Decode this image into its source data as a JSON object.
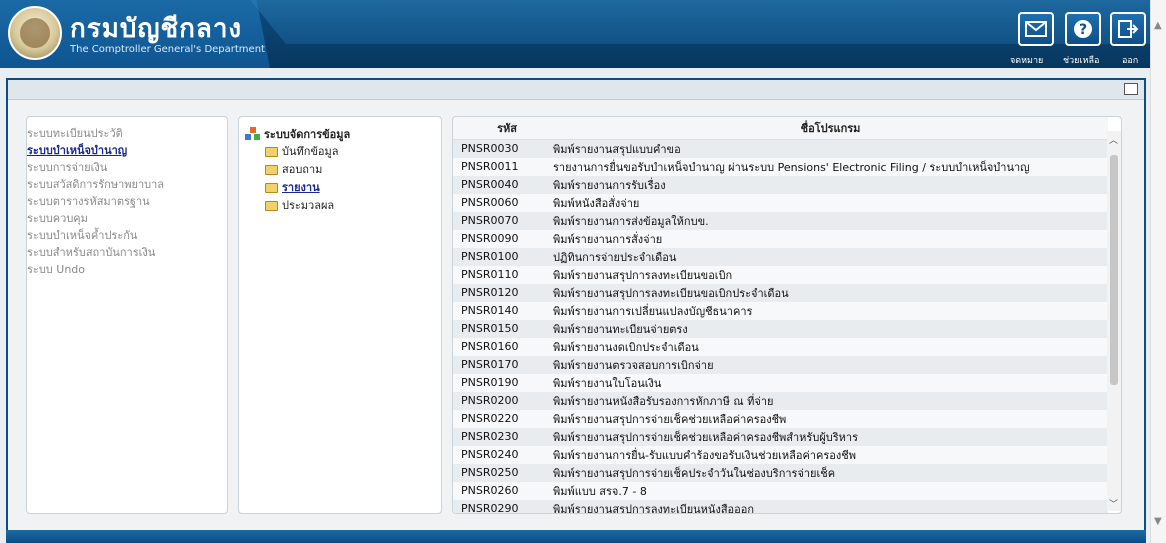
{
  "header": {
    "title": "กรมบัญชีกลาง",
    "subtitle": "The Comptroller General's Department",
    "buttons": [
      {
        "label": "จดหมาย",
        "icon": "mail-icon"
      },
      {
        "label": "ช่วยเหลือ",
        "icon": "help-icon"
      },
      {
        "label": "ออก",
        "icon": "exit-icon"
      }
    ]
  },
  "systems": {
    "items": [
      {
        "label": "ระบบทะเบียนประวัติ",
        "active": false
      },
      {
        "label": "ระบบบำเหน็จบำนาญ",
        "active": true
      },
      {
        "label": "ระบบการจ่ายเงิน",
        "active": false
      },
      {
        "label": "ระบบสวัสดิการรักษาพยาบาล",
        "active": false
      },
      {
        "label": "ระบบตารางรหัสมาตรฐาน",
        "active": false
      },
      {
        "label": "ระบบควบคุม",
        "active": false
      },
      {
        "label": "ระบบบำเหน็จค้ำประกัน",
        "active": false
      },
      {
        "label": "ระบบสำหรับสถาบันการเงิน",
        "active": false
      },
      {
        "label": "ระบบ Undo",
        "active": false
      }
    ]
  },
  "tree": {
    "root": "ระบบจัดการข้อมูล",
    "items": [
      {
        "label": "บันทึกข้อมูล",
        "active": false
      },
      {
        "label": "สอบถาม",
        "active": false
      },
      {
        "label": "รายงาน",
        "active": true
      },
      {
        "label": "ประมวลผล",
        "active": false
      }
    ]
  },
  "table": {
    "headers": {
      "code": "รหัส",
      "name": "ชื่อโปรแกรม"
    },
    "rows": [
      {
        "code": "PNSR0030",
        "name": "พิมพ์รายงานสรุปแบบคำขอ"
      },
      {
        "code": "PNSR0011",
        "name": "รายงานการยื่นขอรับบำเหน็จบำนาญ ผ่านระบบ Pensions' Electronic Filing / ระบบบำเหน็จบำนาญ"
      },
      {
        "code": "PNSR0040",
        "name": "พิมพ์รายงานการรับเรื่อง"
      },
      {
        "code": "PNSR0060",
        "name": "พิมพ์หนังสือสั่งจ่าย"
      },
      {
        "code": "PNSR0070",
        "name": "พิมพ์รายงานการส่งข้อมูลให้กบข."
      },
      {
        "code": "PNSR0090",
        "name": "พิมพ์รายงานการสั่งจ่าย"
      },
      {
        "code": "PNSR0100",
        "name": "ปฏิทินการจ่ายประจำเดือน"
      },
      {
        "code": "PNSR0110",
        "name": "พิมพ์รายงานสรุปการลงทะเบียนขอเบิก"
      },
      {
        "code": "PNSR0120",
        "name": "พิมพ์รายงานสรุปการลงทะเบียนขอเบิกประจำเดือน"
      },
      {
        "code": "PNSR0140",
        "name": "พิมพ์รายงานการเปลี่ยนแปลงบัญชีธนาคาร"
      },
      {
        "code": "PNSR0150",
        "name": "พิมพ์รายงานทะเบียนจ่ายตรง"
      },
      {
        "code": "PNSR0160",
        "name": "พิมพ์รายงานงดเบิกประจำเดือน"
      },
      {
        "code": "PNSR0170",
        "name": "พิมพ์รายงานตรวจสอบการเบิกจ่าย"
      },
      {
        "code": "PNSR0190",
        "name": "พิมพ์รายงานใบโอนเงิน"
      },
      {
        "code": "PNSR0200",
        "name": "พิมพ์รายงานหนังสือรับรองการหักภาษี ณ ที่จ่าย"
      },
      {
        "code": "PNSR0220",
        "name": "พิมพ์รายงานสรุปการจ่ายเช็คช่วยเหลือค่าครองชีพ"
      },
      {
        "code": "PNSR0230",
        "name": "พิมพ์รายงานสรุปการจ่ายเช็คช่วยเหลือค่าครองชีพสำหรับผู้บริหาร"
      },
      {
        "code": "PNSR0240",
        "name": "พิมพ์รายงานการยื่น-รับแบบคำร้องขอรับเงินช่วยเหลือค่าครองชีพ"
      },
      {
        "code": "PNSR0250",
        "name": "พิมพ์รายงานสรุปการจ่ายเช็คประจำวันในช่องบริการจ่ายเช็ค"
      },
      {
        "code": "PNSR0260",
        "name": "พิมพ์แบบ สรจ.7 - 8"
      },
      {
        "code": "PNSR0290",
        "name": "พิมพ์รายงานสรุปการลงทะเบียนหนังสือออก"
      }
    ]
  }
}
